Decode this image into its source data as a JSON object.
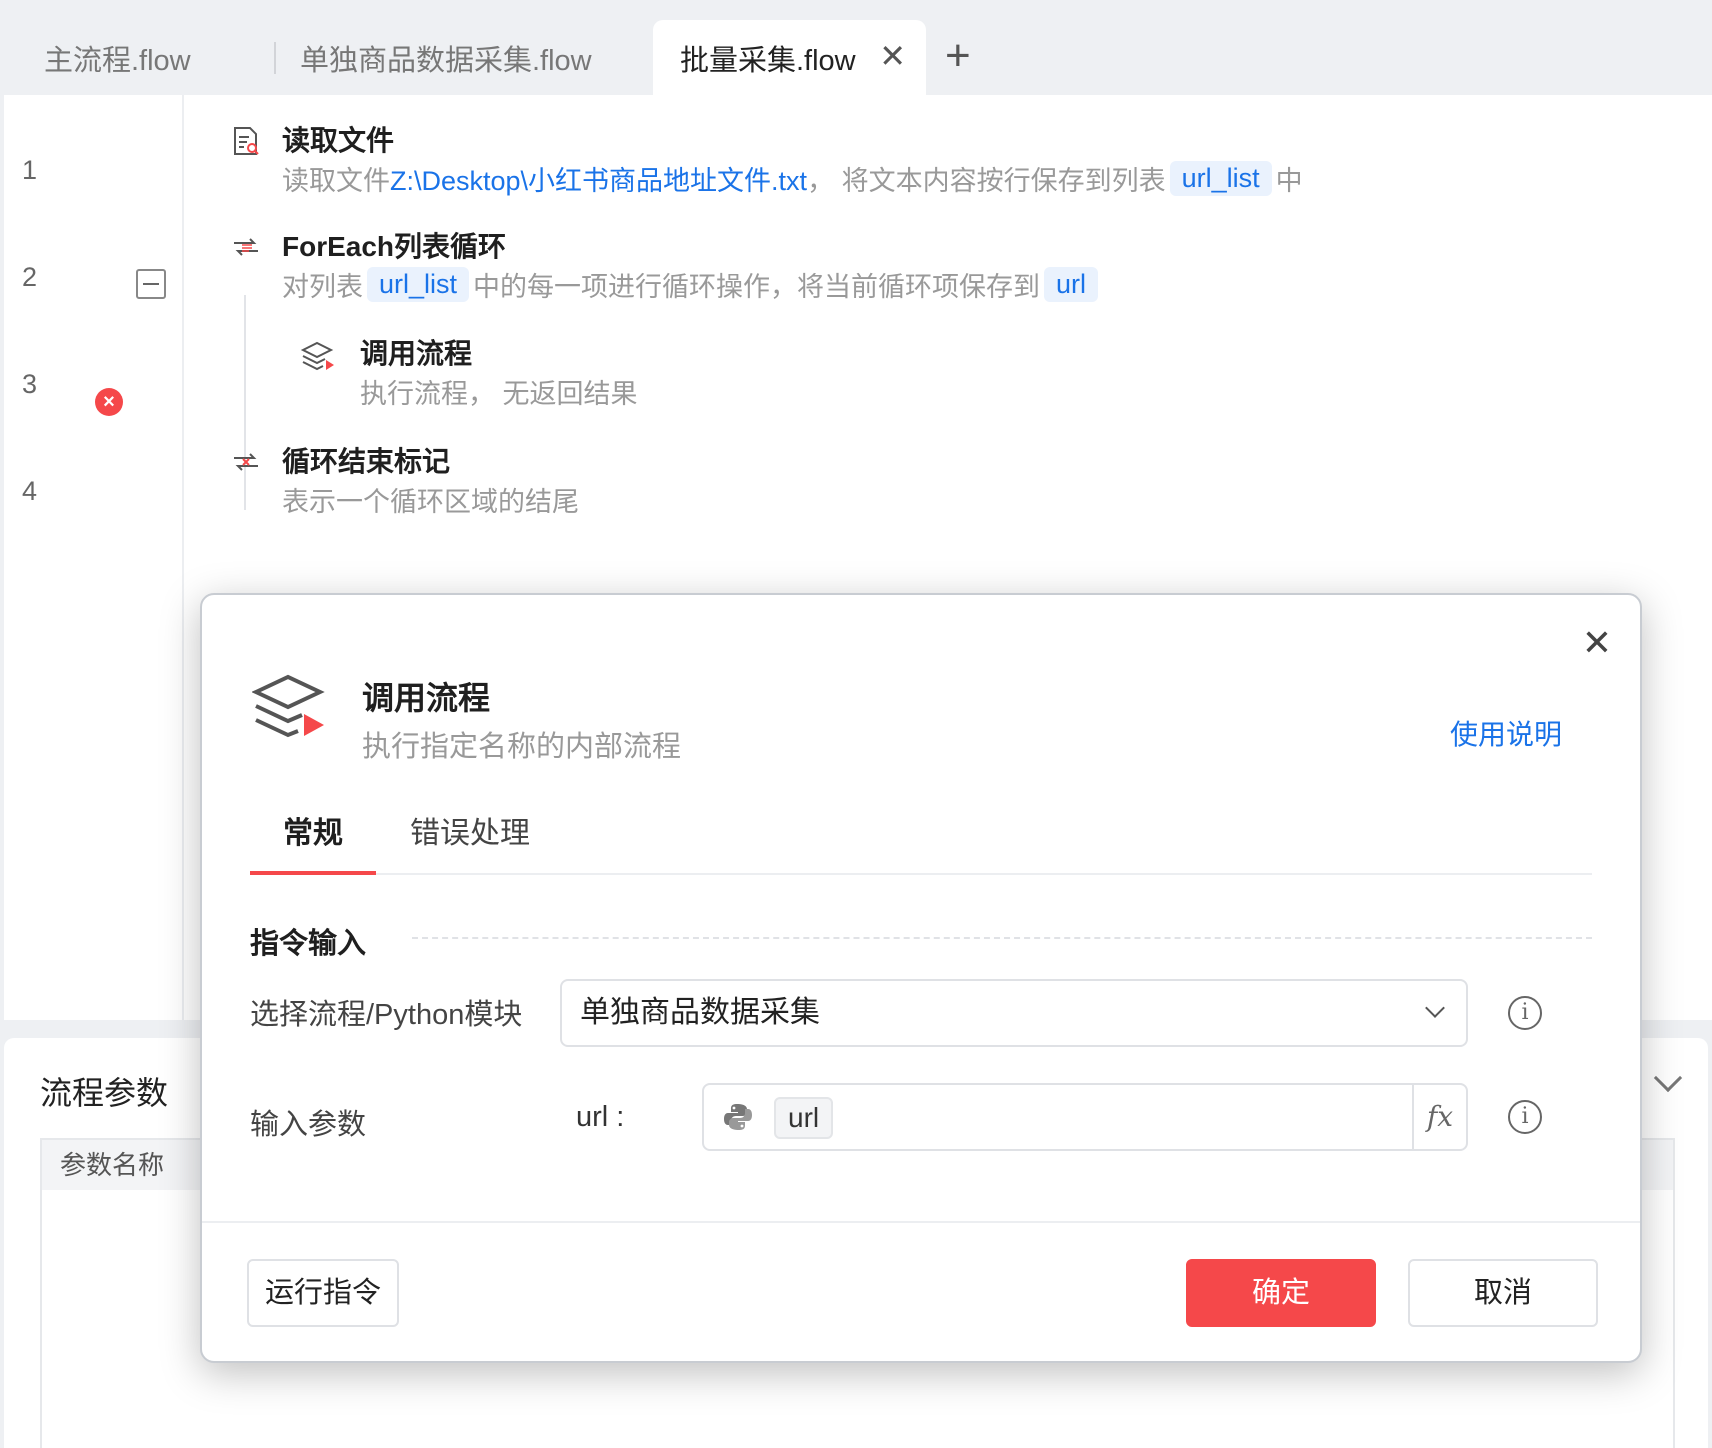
{
  "tabs": [
    {
      "label": "主流程.flow"
    },
    {
      "label": "单独商品数据采集.flow"
    },
    {
      "label": "批量采集.flow",
      "active": true
    }
  ],
  "tab_close": "✕",
  "tab_add": "+",
  "lines": [
    "1",
    "2",
    "3",
    "4"
  ],
  "commands": {
    "read_file": {
      "title": "读取文件",
      "desc_prefix": "读取文件 ",
      "file_path": "Z:\\Desktop\\小红书商品地址文件.txt",
      "desc_mid": "， 将文本内容按行保存到列表",
      "var": "url_list",
      "desc_suffix": "中"
    },
    "foreach": {
      "title": "ForEach列表循环",
      "desc_prefix": "对列表",
      "list_var": "url_list",
      "desc_mid": "中的每一项进行循环操作，将当前循环项保存到",
      "item_var": "url"
    },
    "call_flow": {
      "title": "调用流程",
      "desc": "执行流程， 无返回结果"
    },
    "loop_end": {
      "title": "循环结束标记",
      "desc": "表示一个循环区域的结尾"
    }
  },
  "params_panel": {
    "title": "流程参数",
    "column_header": "参数名称"
  },
  "modal": {
    "title": "调用流程",
    "subtitle": "执行指定名称的内部流程",
    "help_link": "使用说明",
    "close": "✕",
    "tabs": [
      "常规",
      "错误处理"
    ],
    "section_title": "指令输入",
    "select_label": "选择流程/Python模块",
    "select_value": "单独商品数据采集",
    "input_params_label": "输入参数",
    "param_name": "url :",
    "param_value": "url",
    "fx": "fx",
    "info": "i",
    "buttons": {
      "run": "运行指令",
      "ok": "确定",
      "cancel": "取消"
    }
  },
  "colors": {
    "accent_red": "#f5484a",
    "link_blue": "#1a73e8"
  },
  "icons": [
    "read-file-icon",
    "foreach-loop-icon",
    "call-flow-icon",
    "loop-end-icon",
    "error-icon",
    "python-icon",
    "info-icon",
    "fx-icon"
  ]
}
